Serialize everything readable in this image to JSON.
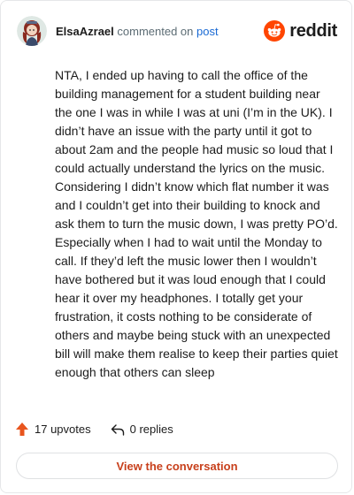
{
  "comment": {
    "author": "ElsaAzrael",
    "action_text": "commented on",
    "post_link": "post",
    "body": "NTA, I ended up having to call the office of the building management for a student building near the one I was in while I was at uni (I’m in the UK). I didn’t have an issue with the party until it got to about 2am and the people had music so loud that I could actually understand the lyrics on the music. Considering I didn’t know which flat number it was and I couldn’t get into their building to knock and ask them to turn the music down, I was pretty PO’d. Especially when I had to wait until the Monday to call. If they’d left the music lower then I wouldn’t have bothered but it was loud enough that I could hear it over my headphones. I totally get your frustration, it costs nothing to be considerate of others and maybe being stuck with an unexpected bill will make them realise to keep their parties quiet enough that others can sleep"
  },
  "brand": {
    "wordmark": "reddit",
    "icon": "reddit-logo-icon",
    "color": "#ff4500"
  },
  "actions": {
    "upvotes_label": "17 upvotes",
    "upvote_icon": "upvote-arrow-icon",
    "upvote_color": "#e8551e",
    "replies_label": "0 replies",
    "reply_icon": "reply-arrow-icon"
  },
  "footer": {
    "button_label": "View the conversation",
    "button_color": "#c8401c"
  }
}
